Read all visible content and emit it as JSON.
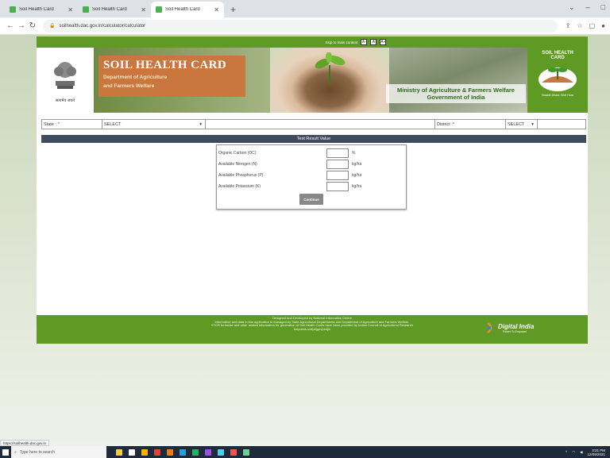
{
  "browser": {
    "tabs": [
      {
        "title": "Soil Health Card",
        "active": false
      },
      {
        "title": "Soil Health Card",
        "active": false
      },
      {
        "title": "Soil Health Card",
        "active": true
      }
    ],
    "url": "soilhealth.dac.gov.in/calculator/calculator",
    "status_url": "https://soilhealth.dac.gov.in"
  },
  "header": {
    "accessibility": "Skip to main content",
    "skip": "Skip to main content",
    "font_buttons": [
      "A-",
      "A",
      "A+"
    ],
    "title": "SOIL HEALTH CARD",
    "subtitle_1": "Department of Agriculture",
    "subtitle_2": "and Farmers Welfare",
    "emblem_text": "सत्यमेव जयते",
    "ministry_1": "Ministry of Agriculture & Farmers Welfare",
    "ministry_2": "Government of India",
    "logo_1": "SOIL HEALTH",
    "logo_2": "CARD",
    "logo_tag": "Swasth Dhara. Khet Hara"
  },
  "filters": {
    "state_label": "State :",
    "state_value": "SELECT",
    "district_label": "District :",
    "district_value": "SELECT",
    "required": "*"
  },
  "result": {
    "header": "Test Result Value",
    "rows": [
      {
        "label": "Organic Carbon (OC)",
        "unit": "%"
      },
      {
        "label": "Available Nitrogen (N)",
        "unit": "kg/ha"
      },
      {
        "label": "Available Phosphorus (P)",
        "unit": "kg/ha"
      },
      {
        "label": "Available Potassium (K)",
        "unit": "kg/ha"
      }
    ],
    "button": "Continue"
  },
  "footer": {
    "line1": "Designed and Developed by National Informatics Centre",
    "line2": "Information and data in this application is managed by State Agricultural Departments and Department of Agriculture and Farmers Welfare.",
    "line3": "STCR formulae and other related information for generation of Soil Health Cards have been provided by Indian Council of Agricultural Research",
    "line4": "helpdesk-soil[at]gov[dot]in",
    "digital_india": "Digital India",
    "digital_tag": "Power To Empower"
  },
  "taskbar": {
    "search_placeholder": "Type here to search",
    "time": "3:21 PM",
    "date": "12/09/2021"
  },
  "colors": {
    "brand_green": "#5f9a24",
    "title_orange": "#c9763f",
    "result_header": "#3f4b5e"
  }
}
